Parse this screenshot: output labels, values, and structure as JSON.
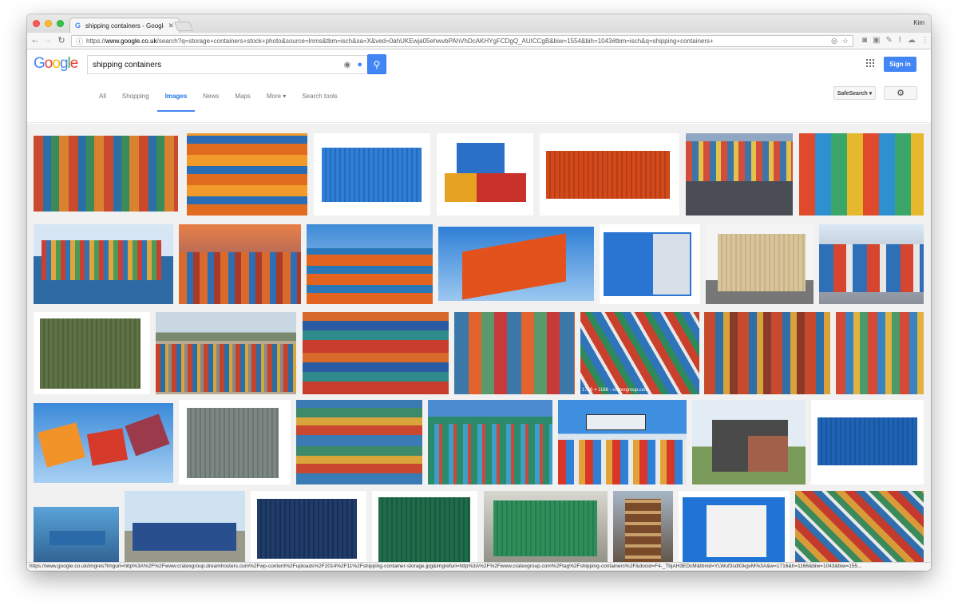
{
  "browser": {
    "tab_title": "shipping containers - Google S",
    "profile": "Kim",
    "url_prefix": "https://",
    "url_host": "www.google.co.uk",
    "url_rest": "/search?q=storage+containers+stock+photo&source=lnms&tbm=isch&sa=X&ved=0ahUKEwja05ehwvbPAhVhDcAKHYgFCDgQ_AUICCgB&biw=1554&bih=1043#tbm=isch&q=shipping+containers+"
  },
  "google": {
    "logo": [
      "G",
      "o",
      "o",
      "g",
      "l",
      "e"
    ],
    "query": "shipping containers",
    "sign_in": "Sign in",
    "tabs": [
      "All",
      "Shopping",
      "Images",
      "News",
      "Maps",
      "More ▾",
      "Search tools"
    ],
    "active_tab": "Images",
    "safesearch": "SafeSearch ▾"
  },
  "results": {
    "caption": "1716 × 1166 - cratexgroup.com",
    "status_url": "https://www.google.co.uk/imgres?imgurl=http%3A%2F%2Fwww.cratexgroup.dreamhosters.com%2Fwp-content%2Fuploads%2F2014%2F11%2Fshipping-container-storage.jpg&imgrefurl=http%3A%2F%2Fwww.cratexgroup.com%2Ftag%2Fshipping-containers%2F&docid=F4-_TbjAH3EDcM&tbnid=YLWuf3sdlGkgvM%3A&w=1716&h=1166&biw=1043&biw=155..."
  },
  "colors": {
    "accent": "#4285f4",
    "container_blue": "#2f7fd6",
    "container_orange": "#e0531f",
    "container_green": "#5e7245",
    "bg_results": "#f1f1f1"
  }
}
